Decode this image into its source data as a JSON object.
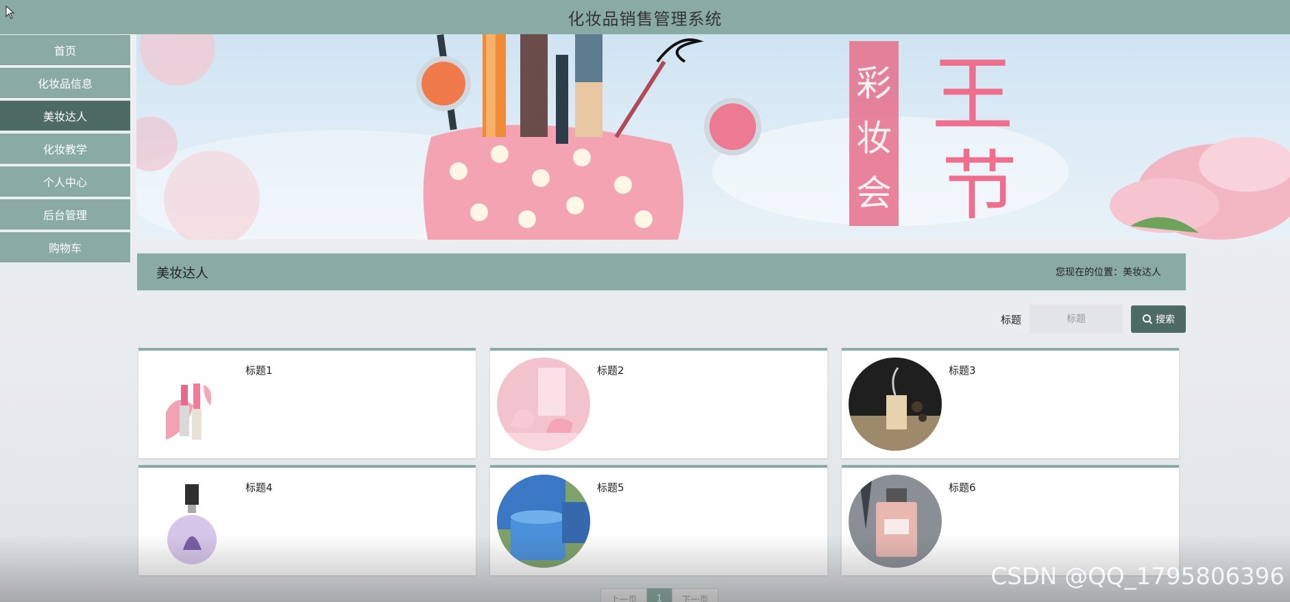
{
  "app": {
    "title": "化妆品销售管理系统"
  },
  "sidebar": {
    "items": [
      {
        "label": "首页",
        "active": false
      },
      {
        "label": "化妆品信息",
        "active": false
      },
      {
        "label": "美妆达人",
        "active": true
      },
      {
        "label": "化妆教学",
        "active": false
      },
      {
        "label": "个人中心",
        "active": false
      },
      {
        "label": "后台管理",
        "active": false
      },
      {
        "label": "购物车",
        "active": false
      }
    ]
  },
  "banner": {
    "text_1": "彩妆会",
    "text_2": "王节"
  },
  "section": {
    "title": "美妆达人",
    "breadcrumb": "您现在的位置：美妆达人"
  },
  "search": {
    "label": "标题",
    "placeholder": "标题",
    "button_label": "搜索"
  },
  "cards": [
    {
      "title": "标题1",
      "image": "lipstick"
    },
    {
      "title": "标题2",
      "image": "pink-beauty-device"
    },
    {
      "title": "标题3",
      "image": "incense-diffuser"
    },
    {
      "title": "标题4",
      "image": "perfume-bottle-purple"
    },
    {
      "title": "标题5",
      "image": "blue-cream-jars"
    },
    {
      "title": "标题6",
      "image": "perfume-eiffel"
    }
  ],
  "pagination": {
    "prev": "上一页",
    "current": "1",
    "next": "下一页"
  },
  "watermark": "CSDN @QQ_1795806396",
  "colors": {
    "primary": "#8aaba3",
    "active": "#4e6b63"
  }
}
